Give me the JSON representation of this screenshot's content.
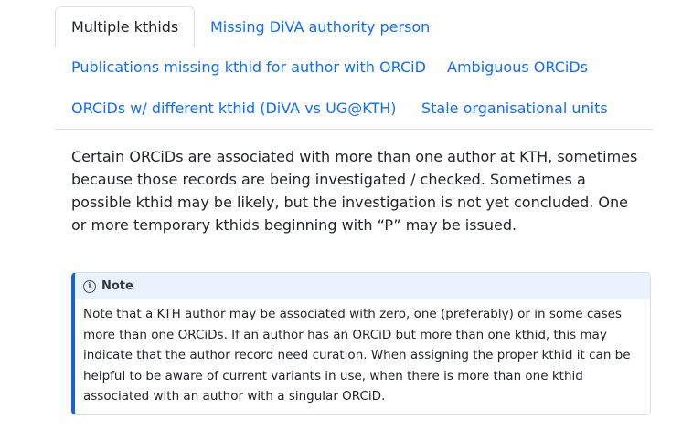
{
  "tabs": [
    {
      "label": "Multiple kthids",
      "active": true
    },
    {
      "label": "Missing DiVA authority person",
      "active": false
    },
    {
      "label": "Publications missing kthid for author with ORCiD",
      "active": false
    },
    {
      "label": "Ambiguous ORCiDs",
      "active": false
    },
    {
      "label": "ORCiDs w/ different kthid (DiVA vs UG@KTH)",
      "active": false
    },
    {
      "label": "Stale organisational units",
      "active": false
    }
  ],
  "intro": "Certain ORCiDs are associated with more than one author at KTH, sometimes because those records are being investigated / checked. Sometimes a possible kthid may be likely, but the investigation is not yet concluded. One or more temporary kthids beginning with “P” may be issued.",
  "note": {
    "icon": "info-icon",
    "title": "Note",
    "body": "Note that a KTH author may be associated with zero, one (preferably) or in some cases more than one ORCiDs. If an author has an ORCiD but more than one kthid, this may indicate that the author record need curation. When assigning the proper kthid it can be helpful to be aware of current variants in use, when there is more than one kthid associated with an author with a singular ORCiD."
  },
  "colors": {
    "link": "#0d6efd",
    "note_accent": "#1565d8",
    "note_header_bg": "#e9f2fd"
  }
}
